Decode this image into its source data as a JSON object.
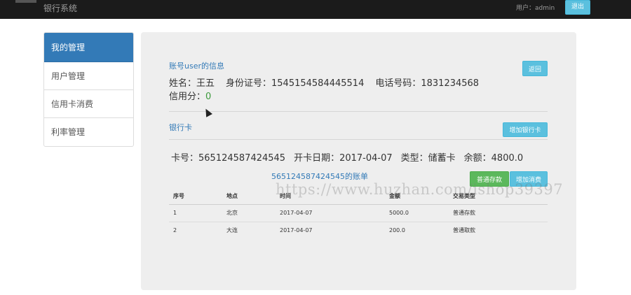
{
  "navbar": {
    "brand": "银行系统",
    "user_label": "用户：admin",
    "logout_label": "退出"
  },
  "sidebar": {
    "items": [
      {
        "label": "我的管理",
        "active": true
      },
      {
        "label": "用户管理",
        "active": false
      },
      {
        "label": "信用卡消费",
        "active": false
      },
      {
        "label": "利率管理",
        "active": false
      }
    ]
  },
  "account": {
    "title": "账号user的信息",
    "back_label": "返回",
    "name_text": "姓名：王五",
    "id_text": "身份证号：1545154584445514",
    "phone_text": "电话号码：1831234568",
    "credit_label": "信用分：",
    "credit_value": "0"
  },
  "bank_card": {
    "title": "银行卡",
    "add_card_label": "增加银行卡",
    "card_no_text": "卡号：565124587424545",
    "open_date_text": "开卡日期：2017-04-07",
    "type_text": "类型：储蓄卡",
    "balance_text": "余额：4800.0"
  },
  "bill": {
    "title": "565124587424545的账单",
    "deposit_label": "普通存款",
    "consume_label": "增加消费",
    "columns": [
      "序号",
      "地点",
      "时间",
      "金额",
      "交易类型"
    ],
    "rows": [
      [
        "1",
        "北京",
        "2017-04-07",
        "5000.0",
        "普通存款"
      ],
      [
        "2",
        "大连",
        "2017-04-07",
        "200.0",
        "普通取款"
      ]
    ]
  },
  "watermark": "https://www.huzhan.com/ishop39397",
  "colors": {
    "primary": "#337ab7",
    "info": "#5bc0de",
    "success": "#5cb85c",
    "navbar": "#1b1b1b",
    "panel": "#eeeeee"
  }
}
